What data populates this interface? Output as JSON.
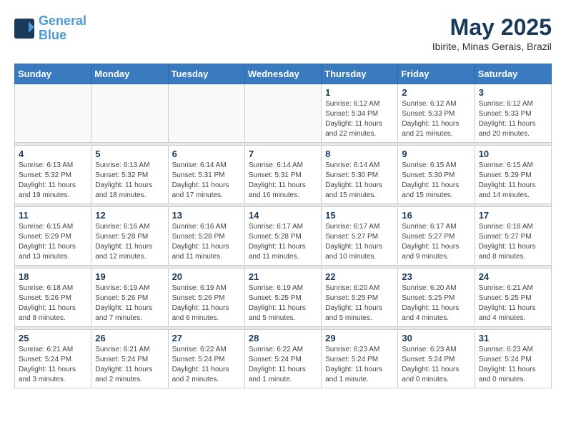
{
  "header": {
    "logo_line1": "General",
    "logo_line2": "Blue",
    "month_title": "May 2025",
    "location": "Ibirite, Minas Gerais, Brazil"
  },
  "days_of_week": [
    "Sunday",
    "Monday",
    "Tuesday",
    "Wednesday",
    "Thursday",
    "Friday",
    "Saturday"
  ],
  "weeks": [
    {
      "days": [
        {
          "num": "",
          "info": ""
        },
        {
          "num": "",
          "info": ""
        },
        {
          "num": "",
          "info": ""
        },
        {
          "num": "",
          "info": ""
        },
        {
          "num": "1",
          "info": "Sunrise: 6:12 AM\nSunset: 5:34 PM\nDaylight: 11 hours\nand 22 minutes."
        },
        {
          "num": "2",
          "info": "Sunrise: 6:12 AM\nSunset: 5:33 PM\nDaylight: 11 hours\nand 21 minutes."
        },
        {
          "num": "3",
          "info": "Sunrise: 6:12 AM\nSunset: 5:33 PM\nDaylight: 11 hours\nand 20 minutes."
        }
      ]
    },
    {
      "days": [
        {
          "num": "4",
          "info": "Sunrise: 6:13 AM\nSunset: 5:32 PM\nDaylight: 11 hours\nand 19 minutes."
        },
        {
          "num": "5",
          "info": "Sunrise: 6:13 AM\nSunset: 5:32 PM\nDaylight: 11 hours\nand 18 minutes."
        },
        {
          "num": "6",
          "info": "Sunrise: 6:14 AM\nSunset: 5:31 PM\nDaylight: 11 hours\nand 17 minutes."
        },
        {
          "num": "7",
          "info": "Sunrise: 6:14 AM\nSunset: 5:31 PM\nDaylight: 11 hours\nand 16 minutes."
        },
        {
          "num": "8",
          "info": "Sunrise: 6:14 AM\nSunset: 5:30 PM\nDaylight: 11 hours\nand 15 minutes."
        },
        {
          "num": "9",
          "info": "Sunrise: 6:15 AM\nSunset: 5:30 PM\nDaylight: 11 hours\nand 15 minutes."
        },
        {
          "num": "10",
          "info": "Sunrise: 6:15 AM\nSunset: 5:29 PM\nDaylight: 11 hours\nand 14 minutes."
        }
      ]
    },
    {
      "days": [
        {
          "num": "11",
          "info": "Sunrise: 6:15 AM\nSunset: 5:29 PM\nDaylight: 11 hours\nand 13 minutes."
        },
        {
          "num": "12",
          "info": "Sunrise: 6:16 AM\nSunset: 5:28 PM\nDaylight: 11 hours\nand 12 minutes."
        },
        {
          "num": "13",
          "info": "Sunrise: 6:16 AM\nSunset: 5:28 PM\nDaylight: 11 hours\nand 11 minutes."
        },
        {
          "num": "14",
          "info": "Sunrise: 6:17 AM\nSunset: 5:28 PM\nDaylight: 11 hours\nand 11 minutes."
        },
        {
          "num": "15",
          "info": "Sunrise: 6:17 AM\nSunset: 5:27 PM\nDaylight: 11 hours\nand 10 minutes."
        },
        {
          "num": "16",
          "info": "Sunrise: 6:17 AM\nSunset: 5:27 PM\nDaylight: 11 hours\nand 9 minutes."
        },
        {
          "num": "17",
          "info": "Sunrise: 6:18 AM\nSunset: 5:27 PM\nDaylight: 11 hours\nand 8 minutes."
        }
      ]
    },
    {
      "days": [
        {
          "num": "18",
          "info": "Sunrise: 6:18 AM\nSunset: 5:26 PM\nDaylight: 11 hours\nand 8 minutes."
        },
        {
          "num": "19",
          "info": "Sunrise: 6:19 AM\nSunset: 5:26 PM\nDaylight: 11 hours\nand 7 minutes."
        },
        {
          "num": "20",
          "info": "Sunrise: 6:19 AM\nSunset: 5:26 PM\nDaylight: 11 hours\nand 6 minutes."
        },
        {
          "num": "21",
          "info": "Sunrise: 6:19 AM\nSunset: 5:25 PM\nDaylight: 11 hours\nand 5 minutes."
        },
        {
          "num": "22",
          "info": "Sunrise: 6:20 AM\nSunset: 5:25 PM\nDaylight: 11 hours\nand 5 minutes."
        },
        {
          "num": "23",
          "info": "Sunrise: 6:20 AM\nSunset: 5:25 PM\nDaylight: 11 hours\nand 4 minutes."
        },
        {
          "num": "24",
          "info": "Sunrise: 6:21 AM\nSunset: 5:25 PM\nDaylight: 11 hours\nand 4 minutes."
        }
      ]
    },
    {
      "days": [
        {
          "num": "25",
          "info": "Sunrise: 6:21 AM\nSunset: 5:24 PM\nDaylight: 11 hours\nand 3 minutes."
        },
        {
          "num": "26",
          "info": "Sunrise: 6:21 AM\nSunset: 5:24 PM\nDaylight: 11 hours\nand 2 minutes."
        },
        {
          "num": "27",
          "info": "Sunrise: 6:22 AM\nSunset: 5:24 PM\nDaylight: 11 hours\nand 2 minutes."
        },
        {
          "num": "28",
          "info": "Sunrise: 6:22 AM\nSunset: 5:24 PM\nDaylight: 11 hours\nand 1 minute."
        },
        {
          "num": "29",
          "info": "Sunrise: 6:23 AM\nSunset: 5:24 PM\nDaylight: 11 hours\nand 1 minute."
        },
        {
          "num": "30",
          "info": "Sunrise: 6:23 AM\nSunset: 5:24 PM\nDaylight: 11 hours\nand 0 minutes."
        },
        {
          "num": "31",
          "info": "Sunrise: 6:23 AM\nSunset: 5:24 PM\nDaylight: 11 hours\nand 0 minutes."
        }
      ]
    }
  ]
}
